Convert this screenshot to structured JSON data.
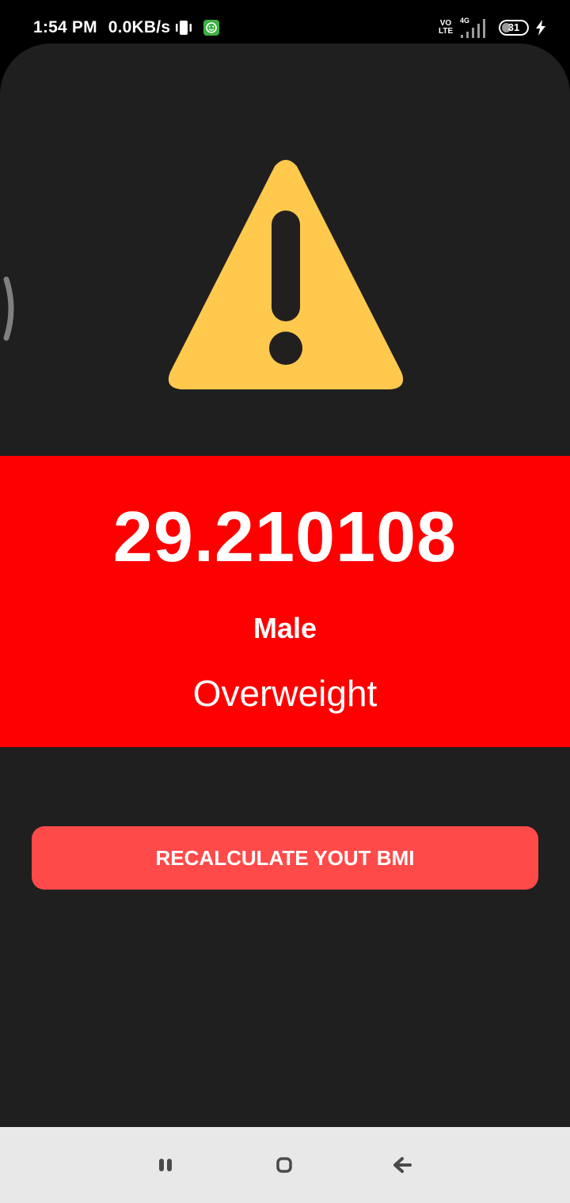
{
  "status_bar": {
    "time": "1:54 PM",
    "network_speed": "0.0KB/s",
    "volte_label_top": "VO",
    "volte_label_bottom": "LTE",
    "network_type": "4G",
    "battery_level": "31",
    "battery_fraction": 0.31,
    "icons": [
      "vibrate-icon",
      "app-notification-icon",
      "volte-icon",
      "signal-icon",
      "battery-icon",
      "charging-icon"
    ]
  },
  "result": {
    "bmi_value": "29.210108",
    "gender": "Male",
    "category": "Overweight",
    "icon": "warning-icon"
  },
  "actions": {
    "recalculate_label": "RECALCULATE YOUT BMI"
  },
  "nav_bar": {
    "icons": [
      "recents-icon",
      "home-icon",
      "back-icon"
    ]
  },
  "colors": {
    "background": "#1f1f1f",
    "result_panel": "#fe0000",
    "button": "#ff4a4a",
    "warning_yellow": "#ffc94d",
    "warning_mark": "#221f1f",
    "nav_bar": "#e8e8e8"
  }
}
